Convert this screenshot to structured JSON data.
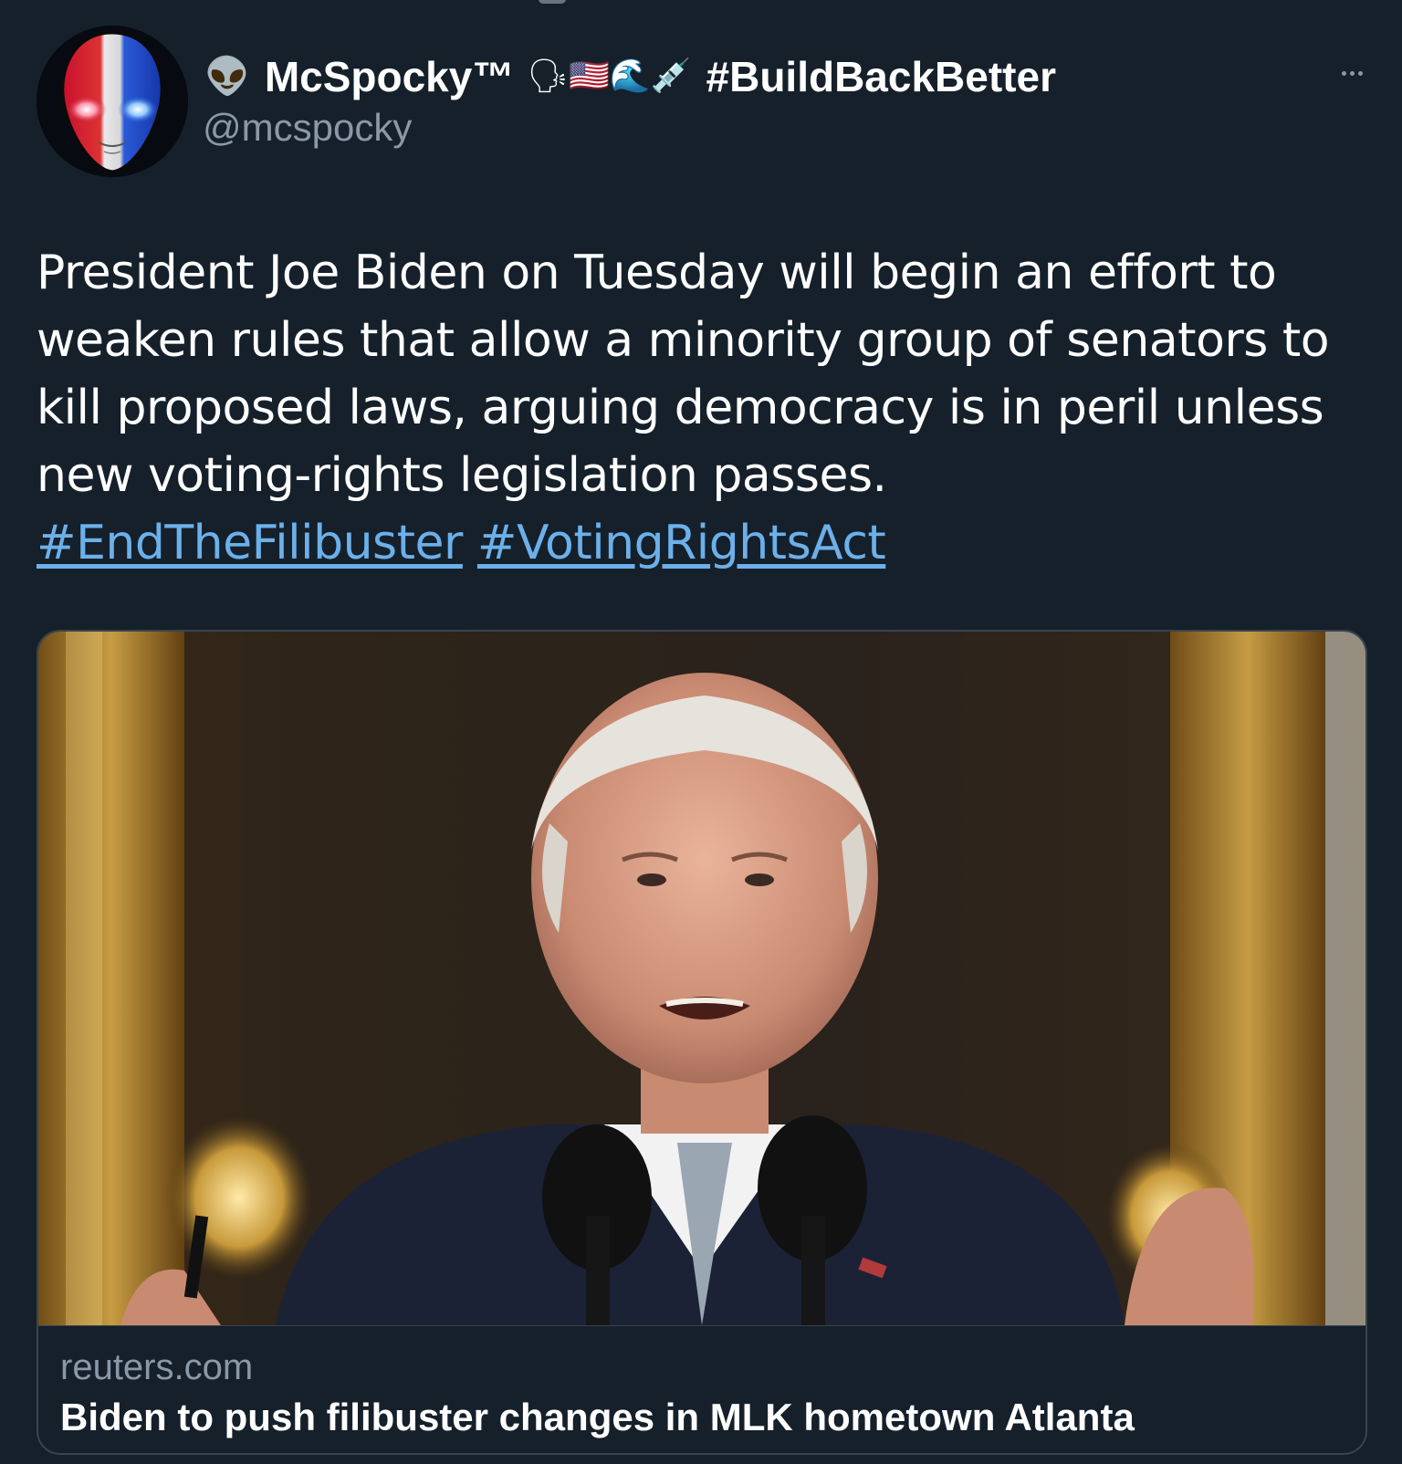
{
  "tweet": {
    "display_name_prefix_emoji": "👽",
    "display_name": "McSpocky™",
    "display_name_suffix_emojis": "🗣🇺🇸🌊💉",
    "display_name_tag": "#BuildBackBetter",
    "handle": "@mcspocky",
    "more_icon": "ellipsis-icon",
    "text_lines": [
      "President Joe Biden on Tuesday will begin an effort to",
      "weaken rules that allow a minority group of senators to",
      "kill proposed laws, arguing democracy is in peril unless",
      "new voting-rights legislation passes."
    ],
    "hashtags": [
      "#EndTheFilibuster",
      "#VotingRightsAct"
    ]
  },
  "card": {
    "domain": "reuters.com",
    "title": "Biden to push filibuster changes in MLK hometown Atlanta"
  },
  "colors": {
    "background": "#15202b",
    "text": "#ffffff",
    "secondary_text": "#8b98a5",
    "link": "#6cb0ea",
    "border": "#38444d"
  }
}
